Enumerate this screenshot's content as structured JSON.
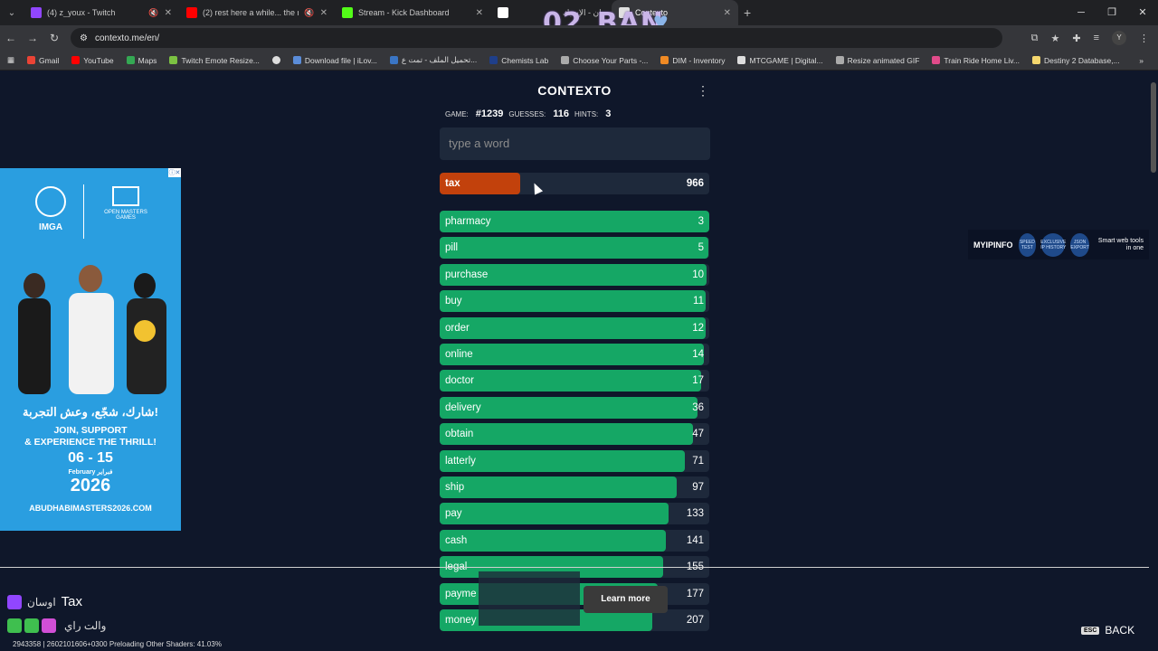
{
  "browser": {
    "tabs": [
      {
        "title": "(4) z_youx - Twitch",
        "color": "#9146ff"
      },
      {
        "title": "(2) rest here a while... the rain w",
        "color": "#ff0000"
      },
      {
        "title": "Stream - Kick Dashboard",
        "color": "#53fc18"
      },
      {
        "title": "",
        "color": "#ffffff"
      },
      {
        "title": "أوسان - الإسبك",
        "color": "#888888"
      },
      {
        "title": "Contexto",
        "color": "#e0e0e0"
      }
    ],
    "url": "contexto.me/en/",
    "profile_initial": "Y",
    "bookmarks": [
      {
        "label": "Gmail",
        "color": "#ea4335"
      },
      {
        "label": "YouTube",
        "color": "#ff0000"
      },
      {
        "label": "Maps",
        "color": "#34a853"
      },
      {
        "label": "Twitch Emote Resize...",
        "color": "#7cc242"
      },
      {
        "label": "",
        "color": "#dddddd"
      },
      {
        "label": "Download file | iLov...",
        "color": "#5b8dd9"
      },
      {
        "label": "تحميل الملف - تمت ع...",
        "color": "#3a75c4"
      },
      {
        "label": "Chemists Lab",
        "color": "#1f3f8a"
      },
      {
        "label": "Choose Your Parts -...",
        "color": "#aaaaaa"
      },
      {
        "label": "DIM - Inventory",
        "color": "#f08a24"
      },
      {
        "label": "MTCGAME | Digital...",
        "color": "#dddddd"
      },
      {
        "label": "Resize animated GIF",
        "color": "#aaaaaa"
      },
      {
        "label": "Train Ride Home Liv...",
        "color": "#e14b8a"
      },
      {
        "label": "Destiny 2 Database,...",
        "color": "#f5d76e"
      }
    ]
  },
  "overlay": {
    "name": "02_BAN"
  },
  "contexto": {
    "title": "CONTEXTO",
    "game_label": "GAME:",
    "game_number": "#1239",
    "guesses_label": "GUESSES:",
    "guesses": "116",
    "hints_label": "HINTS:",
    "hints": "3",
    "input_placeholder": "type a word",
    "last_guess": {
      "word": "tax",
      "rank": "966",
      "fill": 0.3
    },
    "guesses_list": [
      {
        "word": "pharmacy",
        "rank": "3",
        "fill": 1.0
      },
      {
        "word": "pill",
        "rank": "5",
        "fill": 0.995
      },
      {
        "word": "purchase",
        "rank": "10",
        "fill": 0.99
      },
      {
        "word": "buy",
        "rank": "11",
        "fill": 0.988
      },
      {
        "word": "order",
        "rank": "12",
        "fill": 0.985
      },
      {
        "word": "online",
        "rank": "14",
        "fill": 0.98
      },
      {
        "word": "doctor",
        "rank": "17",
        "fill": 0.97
      },
      {
        "word": "delivery",
        "rank": "36",
        "fill": 0.955
      },
      {
        "word": "obtain",
        "rank": "47",
        "fill": 0.94
      },
      {
        "word": "latterly",
        "rank": "71",
        "fill": 0.91
      },
      {
        "word": "ship",
        "rank": "97",
        "fill": 0.88
      },
      {
        "word": "pay",
        "rank": "133",
        "fill": 0.85
      },
      {
        "word": "cash",
        "rank": "141",
        "fill": 0.84
      },
      {
        "word": "legal",
        "rank": "155",
        "fill": 0.83
      },
      {
        "word": "payme",
        "rank": "177",
        "fill": 0.81
      },
      {
        "word": "money",
        "rank": "207",
        "fill": 0.79
      }
    ]
  },
  "ad": {
    "close": "ⓘ✕",
    "imga": "IMGA",
    "open_masters": "OPEN MASTERS GAMES",
    "arabic": "شارك، شجّع، وعش التجربة!",
    "join": "JOIN, SUPPORT\n& EXPERIENCE THE THRILL!",
    "dates": "06 - 15",
    "month": "February فبراير",
    "year": "2026",
    "url": "ABUDHABIMASTERS2026.COM"
  },
  "myipinfo": {
    "brand": "MYIPINFO",
    "badges": [
      "SPEED TEST",
      "EXCLUSIVE IP HISTORY",
      "JSON EXPORT"
    ],
    "tagline": "Smart web tools in one"
  },
  "learn_more": "Learn more",
  "chat": [
    {
      "user": "اوسان",
      "message": "Tax"
    },
    {
      "user": "والت راي",
      "message": ""
    }
  ],
  "stream_status": "2943358 | 2602101606+0300   Preloading Other Shaders: 41.03%",
  "back": {
    "key": "ESC",
    "label": "BACK"
  }
}
